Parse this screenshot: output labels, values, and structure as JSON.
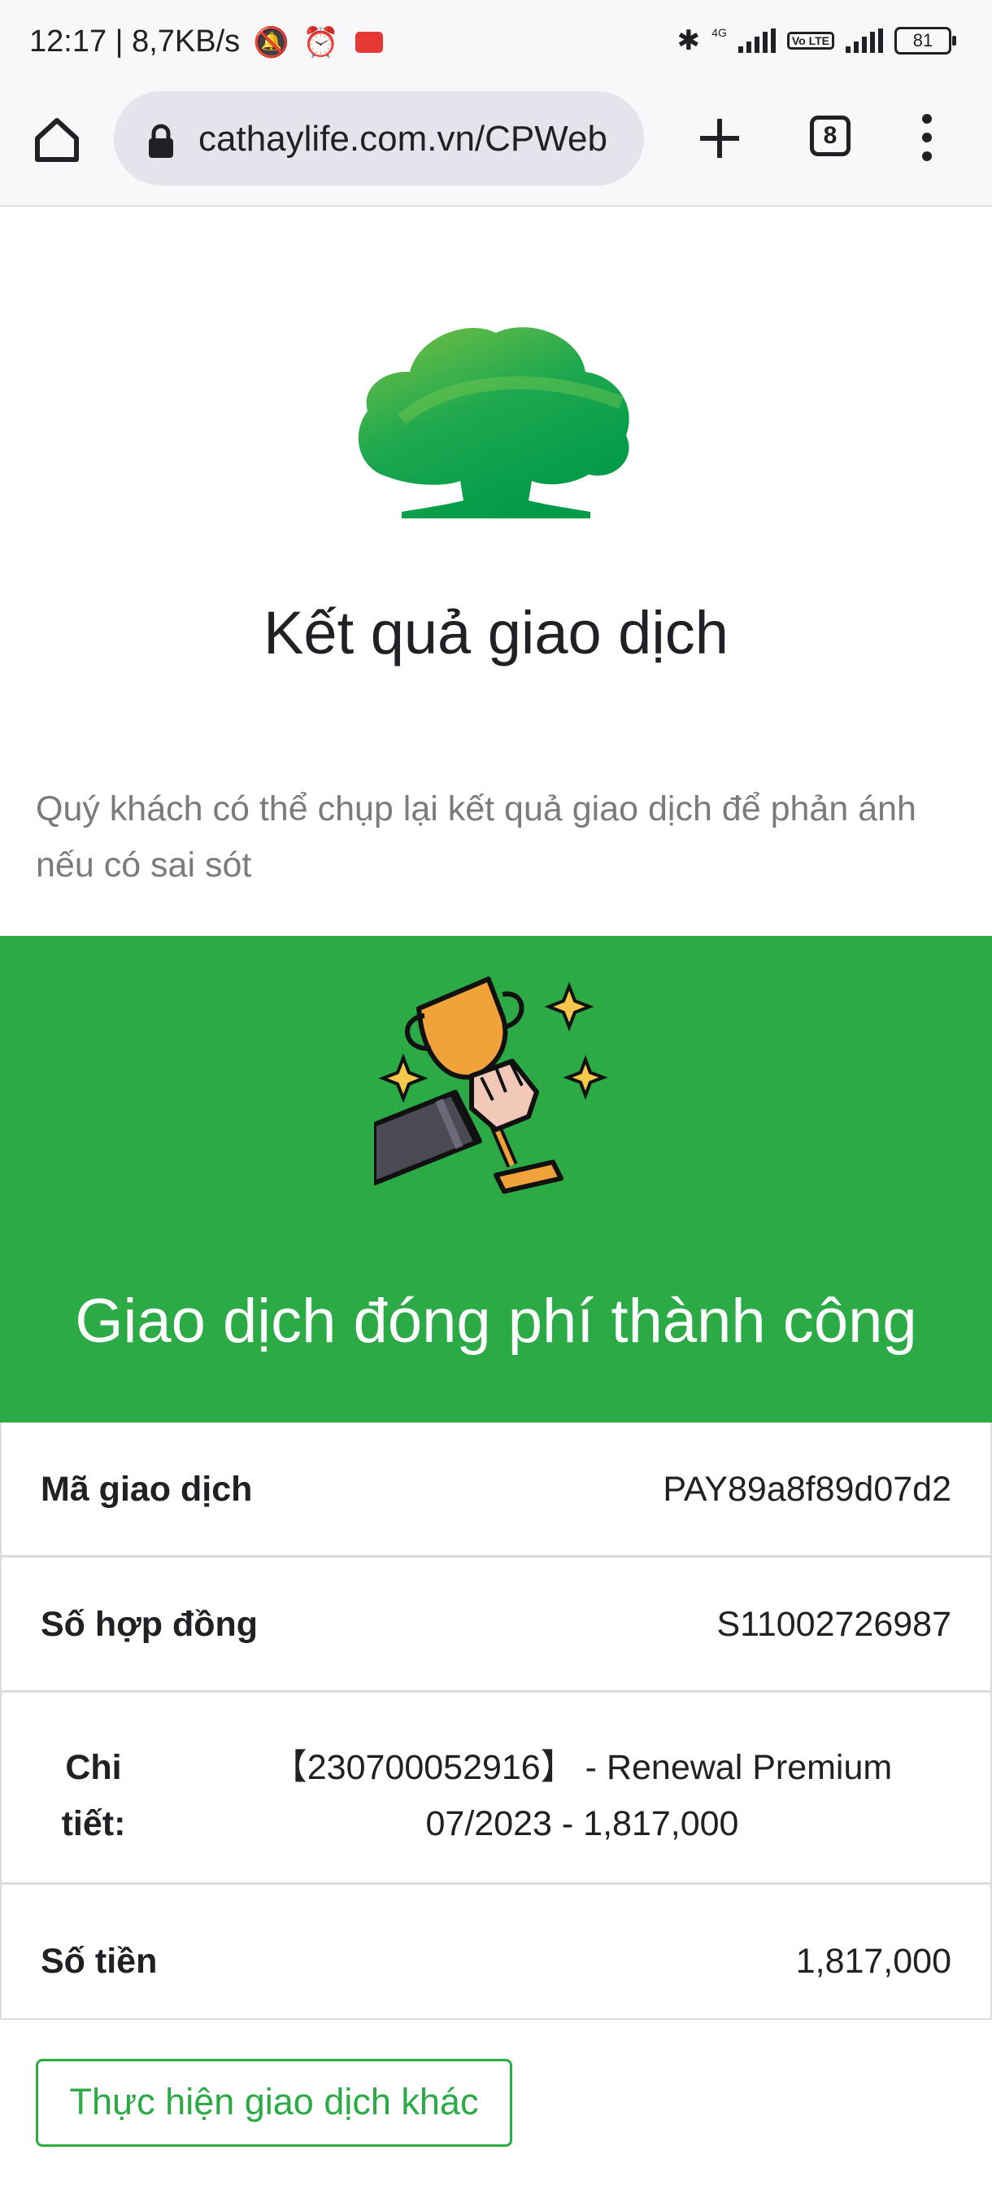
{
  "status_bar": {
    "time_speed": "12:17 | 8,7KB/s",
    "network": "4G",
    "volte": "Vo LTE",
    "battery": "81"
  },
  "browser": {
    "url": "cathaylife.com.vn/CPWeb",
    "tab_count": "8"
  },
  "page": {
    "title": "Kết quả giao dịch",
    "notice": "Quý khách có thể chụp lại kết quả giao dịch để phản ánh nếu có sai sót",
    "banner_title": "Giao dịch đóng phí thành công"
  },
  "details": {
    "transaction_id_label": "Mã giao dịch",
    "transaction_id_value": "PAY89a8f89d07d2",
    "contract_label": "Số hợp đồng",
    "contract_value": "S11002726987",
    "detail_label": "Chi tiết:",
    "detail_value": "【230700052916】 - Renewal Premium 07/2023 - 1,817,000",
    "amount_label": "Số tiền",
    "amount_value": "1,817,000"
  },
  "actions": {
    "other_transaction": "Thực hiện giao dịch khác"
  },
  "colors": {
    "brand_green": "#2baa45",
    "logo_green": "#009a49",
    "text_muted": "#7b7b7b"
  }
}
